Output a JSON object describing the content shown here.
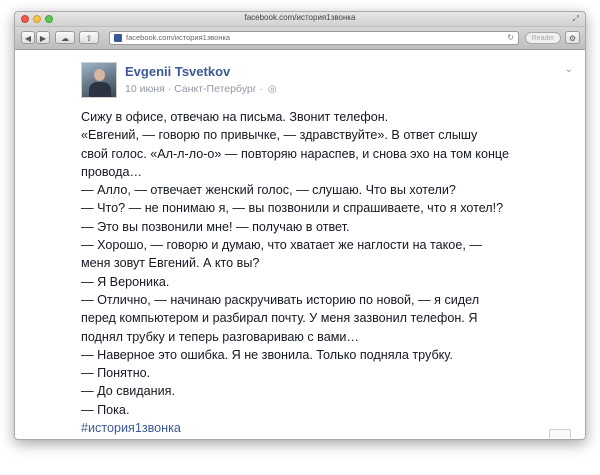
{
  "window": {
    "title": "facebook.com/история1звонка"
  },
  "toolbar": {
    "back_icon": "◀",
    "forward_icon": "▶",
    "icloud_icon": "☁",
    "share_icon": "⇪",
    "url": "facebook.com/история1звонка",
    "reload_icon": "↻",
    "reader_label": "Reader",
    "settings_icon": "⚙"
  },
  "post": {
    "author": "Evgenii Tsvetkov",
    "date": "10 июня",
    "separator": " · ",
    "location": "Санкт-Петербург",
    "separator2": " · ",
    "privacy_icon": "◎",
    "menu_icon": "⌄",
    "lines": [
      "Сижу в офисе, отвечаю на письма. Звонит телефон.",
      "«Евгений, — говорю по привычке, — здравствуйте». В ответ слышу",
      "свой голос. «Ал-л-ло-о» — повторяю нараспев, и снова эхо на том конце",
      "провода…",
      "— Алло, — отвечает женский голос, — слушаю. Что вы хотели?",
      "— Что? — не понимаю я, — вы позвонили и спрашиваете, что я хотел!?",
      "— Это вы позвонили мне! — получаю в ответ.",
      "— Хорошо, — говорю и думаю, что хватает же наглости на такое, —",
      "меня зовут Евгений. А кто вы?",
      "— Я Вероника.",
      "— Отлично, — начинаю раскручивать историю по новой, — я сидел",
      "перед компьютером и разбирал почту. У меня зазвонил телефон. Я",
      "поднял трубку и теперь разговариваю с вами…",
      "— Наверное это ошибка. Я не звонила. Только подняла трубку.",
      "— Понятно.",
      "— До свидания.",
      "— Пока."
    ],
    "hashtag": "#история1звонка"
  }
}
